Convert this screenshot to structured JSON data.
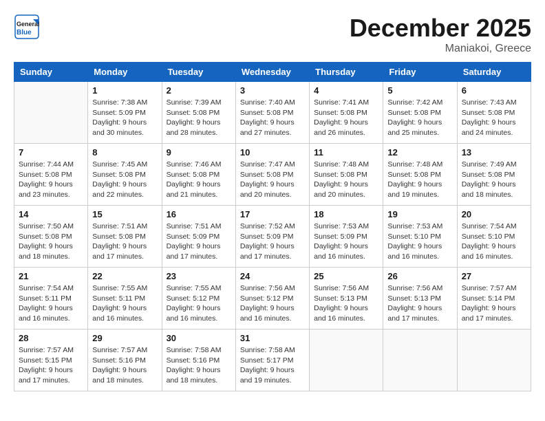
{
  "header": {
    "logo_line1": "General",
    "logo_line2": "Blue",
    "month": "December 2025",
    "location": "Maniakoi, Greece"
  },
  "weekdays": [
    "Sunday",
    "Monday",
    "Tuesday",
    "Wednesday",
    "Thursday",
    "Friday",
    "Saturday"
  ],
  "weeks": [
    [
      {
        "day": "",
        "info": ""
      },
      {
        "day": "1",
        "sunrise": "7:38 AM",
        "sunset": "5:09 PM",
        "daylight": "9 hours and 30 minutes."
      },
      {
        "day": "2",
        "sunrise": "7:39 AM",
        "sunset": "5:08 PM",
        "daylight": "9 hours and 28 minutes."
      },
      {
        "day": "3",
        "sunrise": "7:40 AM",
        "sunset": "5:08 PM",
        "daylight": "9 hours and 27 minutes."
      },
      {
        "day": "4",
        "sunrise": "7:41 AM",
        "sunset": "5:08 PM",
        "daylight": "9 hours and 26 minutes."
      },
      {
        "day": "5",
        "sunrise": "7:42 AM",
        "sunset": "5:08 PM",
        "daylight": "9 hours and 25 minutes."
      },
      {
        "day": "6",
        "sunrise": "7:43 AM",
        "sunset": "5:08 PM",
        "daylight": "9 hours and 24 minutes."
      }
    ],
    [
      {
        "day": "7",
        "sunrise": "7:44 AM",
        "sunset": "5:08 PM",
        "daylight": "9 hours and 23 minutes."
      },
      {
        "day": "8",
        "sunrise": "7:45 AM",
        "sunset": "5:08 PM",
        "daylight": "9 hours and 22 minutes."
      },
      {
        "day": "9",
        "sunrise": "7:46 AM",
        "sunset": "5:08 PM",
        "daylight": "9 hours and 21 minutes."
      },
      {
        "day": "10",
        "sunrise": "7:47 AM",
        "sunset": "5:08 PM",
        "daylight": "9 hours and 20 minutes."
      },
      {
        "day": "11",
        "sunrise": "7:48 AM",
        "sunset": "5:08 PM",
        "daylight": "9 hours and 20 minutes."
      },
      {
        "day": "12",
        "sunrise": "7:48 AM",
        "sunset": "5:08 PM",
        "daylight": "9 hours and 19 minutes."
      },
      {
        "day": "13",
        "sunrise": "7:49 AM",
        "sunset": "5:08 PM",
        "daylight": "9 hours and 18 minutes."
      }
    ],
    [
      {
        "day": "14",
        "sunrise": "7:50 AM",
        "sunset": "5:08 PM",
        "daylight": "9 hours and 18 minutes."
      },
      {
        "day": "15",
        "sunrise": "7:51 AM",
        "sunset": "5:08 PM",
        "daylight": "9 hours and 17 minutes."
      },
      {
        "day": "16",
        "sunrise": "7:51 AM",
        "sunset": "5:09 PM",
        "daylight": "9 hours and 17 minutes."
      },
      {
        "day": "17",
        "sunrise": "7:52 AM",
        "sunset": "5:09 PM",
        "daylight": "9 hours and 17 minutes."
      },
      {
        "day": "18",
        "sunrise": "7:53 AM",
        "sunset": "5:09 PM",
        "daylight": "9 hours and 16 minutes."
      },
      {
        "day": "19",
        "sunrise": "7:53 AM",
        "sunset": "5:10 PM",
        "daylight": "9 hours and 16 minutes."
      },
      {
        "day": "20",
        "sunrise": "7:54 AM",
        "sunset": "5:10 PM",
        "daylight": "9 hours and 16 minutes."
      }
    ],
    [
      {
        "day": "21",
        "sunrise": "7:54 AM",
        "sunset": "5:11 PM",
        "daylight": "9 hours and 16 minutes."
      },
      {
        "day": "22",
        "sunrise": "7:55 AM",
        "sunset": "5:11 PM",
        "daylight": "9 hours and 16 minutes."
      },
      {
        "day": "23",
        "sunrise": "7:55 AM",
        "sunset": "5:12 PM",
        "daylight": "9 hours and 16 minutes."
      },
      {
        "day": "24",
        "sunrise": "7:56 AM",
        "sunset": "5:12 PM",
        "daylight": "9 hours and 16 minutes."
      },
      {
        "day": "25",
        "sunrise": "7:56 AM",
        "sunset": "5:13 PM",
        "daylight": "9 hours and 16 minutes."
      },
      {
        "day": "26",
        "sunrise": "7:56 AM",
        "sunset": "5:13 PM",
        "daylight": "9 hours and 17 minutes."
      },
      {
        "day": "27",
        "sunrise": "7:57 AM",
        "sunset": "5:14 PM",
        "daylight": "9 hours and 17 minutes."
      }
    ],
    [
      {
        "day": "28",
        "sunrise": "7:57 AM",
        "sunset": "5:15 PM",
        "daylight": "9 hours and 17 minutes."
      },
      {
        "day": "29",
        "sunrise": "7:57 AM",
        "sunset": "5:16 PM",
        "daylight": "9 hours and 18 minutes."
      },
      {
        "day": "30",
        "sunrise": "7:58 AM",
        "sunset": "5:16 PM",
        "daylight": "9 hours and 18 minutes."
      },
      {
        "day": "31",
        "sunrise": "7:58 AM",
        "sunset": "5:17 PM",
        "daylight": "9 hours and 19 minutes."
      },
      {
        "day": "",
        "info": ""
      },
      {
        "day": "",
        "info": ""
      },
      {
        "day": "",
        "info": ""
      }
    ]
  ]
}
